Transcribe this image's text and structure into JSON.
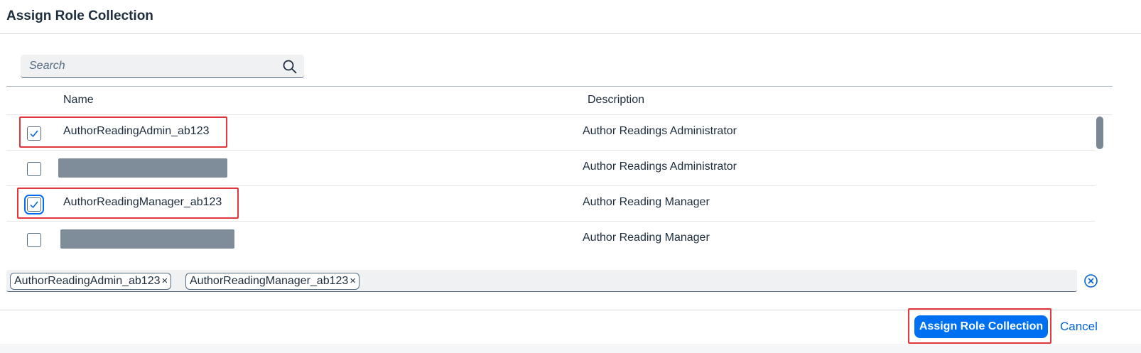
{
  "dialog": {
    "title": "Assign Role Collection"
  },
  "search": {
    "placeholder": "Search",
    "icon": "search-icon"
  },
  "table": {
    "headers": {
      "name": "Name",
      "description": "Description"
    },
    "rows": [
      {
        "name": "AuthorReadingAdmin_ab123",
        "description": "Author Readings Administrator",
        "checked": true,
        "redacted": false
      },
      {
        "name": "",
        "description": "Author Readings Administrator",
        "checked": false,
        "redacted": true
      },
      {
        "name": "AuthorReadingManager_ab123",
        "description": "Author Reading Manager",
        "checked": true,
        "redacted": false
      },
      {
        "name": "",
        "description": "Author Reading Manager",
        "checked": false,
        "redacted": true
      }
    ]
  },
  "tokens": [
    {
      "label": "AuthorReadingAdmin_ab123",
      "remove": "×"
    },
    {
      "label": "AuthorReadingManager_ab123",
      "remove": "×"
    }
  ],
  "footer": {
    "assign_label": "Assign Role Collection",
    "cancel_label": "Cancel"
  },
  "colors": {
    "accent": "#0070f2",
    "highlight": "#e2363a",
    "redaction": "#7f8c99"
  }
}
